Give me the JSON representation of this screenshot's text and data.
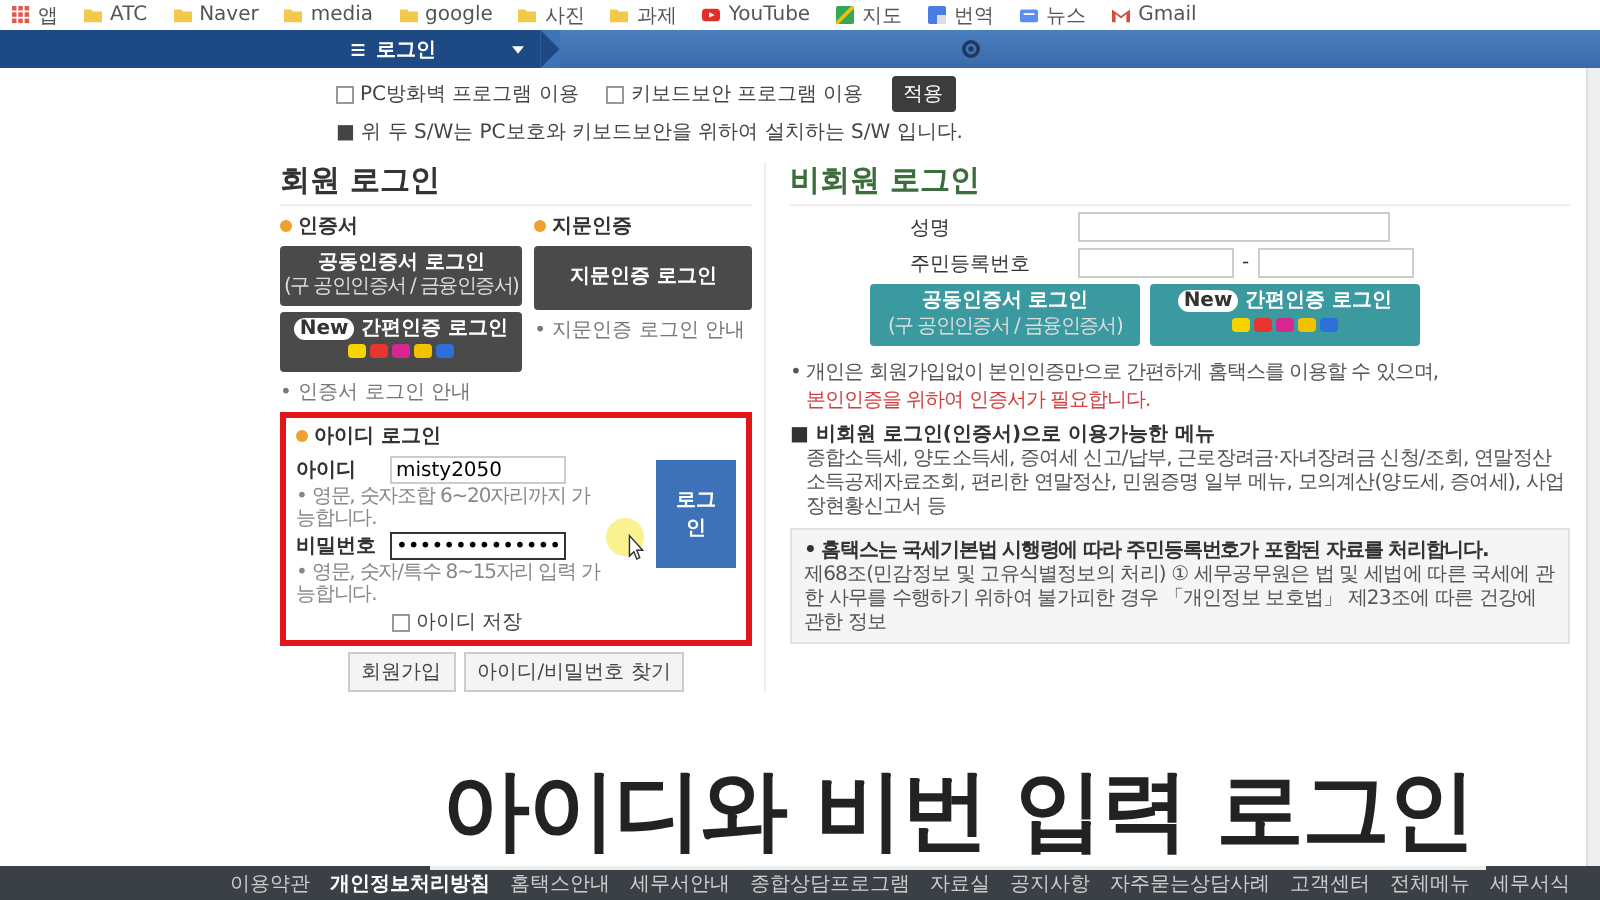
{
  "bookmarks": [
    {
      "kind": "apps",
      "label": "앱"
    },
    {
      "kind": "folder",
      "label": "ATC"
    },
    {
      "kind": "folder",
      "label": "Naver"
    },
    {
      "kind": "folder",
      "label": "media"
    },
    {
      "kind": "folder",
      "label": "google"
    },
    {
      "kind": "folder",
      "label": "사진"
    },
    {
      "kind": "folder",
      "label": "과제"
    },
    {
      "kind": "youtube",
      "label": "YouTube"
    },
    {
      "kind": "map",
      "label": "지도"
    },
    {
      "kind": "translate",
      "label": "번역"
    },
    {
      "kind": "news",
      "label": "뉴스"
    },
    {
      "kind": "gmail",
      "label": "Gmail"
    }
  ],
  "nav": {
    "title": "로그인"
  },
  "options": {
    "checkboxes": [
      {
        "label": "PC방화벽 프로그램 이용",
        "checked": false
      },
      {
        "label": "키보드보안 프로그램 이용",
        "checked": false
      }
    ],
    "apply_button": "적용",
    "note": "■ 위 두 S/W는 PC보호와 키보드보안을 위하여 설치하는 S/W 입니다."
  },
  "member_login": {
    "title": "회원 로그인",
    "certificate": {
      "label": "인증서",
      "button": "공동인증서 로그인",
      "button_sub": "(구 공인인증서 / 금융인증서)",
      "easy_button": {
        "badge": "New",
        "label": "간편인증 로그인",
        "providers": [
          {
            "color": "#f7d300"
          },
          {
            "color": "#e8342f"
          },
          {
            "color": "#d9258f"
          },
          {
            "color": "#f2c200"
          },
          {
            "color": "#2f6fd8"
          }
        ]
      },
      "guide": "• 인증서 로그인 안내"
    },
    "fingerprint": {
      "label": "지문인증",
      "button": "지문인증 로그인",
      "guide": "• 지문인증 로그인 안내"
    },
    "id_login": {
      "label": "아이디 로그인",
      "highlighted": true,
      "id_label": "아이디",
      "id_value": "misty2050",
      "id_hint": "• 영문, 숫자조합 6~20자리까지 가능합니다.",
      "pw_label": "비밀번호",
      "pw_value": "••••••••••••••",
      "pw_hint": "• 영문, 숫자/특수 8~15자리 입력 가능합니다.",
      "save_id": {
        "label": "아이디 저장",
        "checked": false
      },
      "login_button": "로그인"
    },
    "buttons": [
      "회원가입",
      "아이디/비밀번호 찾기"
    ]
  },
  "guest_login": {
    "title": "비회원 로그인",
    "name_label": "성명",
    "rrn_label": "주민등록번호",
    "rrn_separator": "-",
    "cert_button": "공동인증서 로그인",
    "cert_button_sub": "(구 공인인증서 / 금융인증서)",
    "easy_button": {
      "badge": "New",
      "label": "간편인증 로그인",
      "providers": [
        {
          "color": "#f7d300"
        },
        {
          "color": "#e8342f"
        },
        {
          "color": "#d9258f"
        },
        {
          "color": "#f2c200"
        },
        {
          "color": "#2f6fd8"
        }
      ]
    },
    "info": "• 개인은 회원가입없이 본인인증만으로 간편하게 홈택스를 이용할 수 있으며,",
    "info_warning": "본인인증을 위하여 인증서가 필요합니다.",
    "menu_title": "■ 비회원 로그인(인증서)으로 이용가능한 메뉴",
    "menu_body": "종합소득세, 양도소득세, 증여세 신고/납부, 근로장려금·자녀장려금 신청/조회, 연말정산 소득공제자료조회, 편리한 연말정산, 민원증명 일부 메뉴, 모의계산(양도세, 증여세), 사업장현황신고서 등",
    "notice_title": "• 홈택스는 국세기본법 시행령에 따라 주민등록번호가 포함된 자료를 처리합니다.",
    "notice_body": "제68조(민감정보 및 고유식별정보의 처리) ① 세무공무원은 법 및 세법에 따른 국세에 관한 사무를 수행하기 위하여 불가피한 경우 「개인정보 보호법」 제23조에 따른 건강에 관한 정보"
  },
  "caption": "아이디와 비번 입력 로그인",
  "footer": [
    {
      "label": "이용약관",
      "highlighted": false
    },
    {
      "label": "개인정보처리방침",
      "highlighted": true
    },
    {
      "label": "홈택스안내",
      "highlighted": false
    },
    {
      "label": "세무서안내",
      "highlighted": false
    },
    {
      "label": "종합상담프로그램",
      "highlighted": false
    },
    {
      "label": "자료실",
      "highlighted": false
    },
    {
      "label": "공지사항",
      "highlighted": false
    },
    {
      "label": "자주묻는상담사례",
      "highlighted": false
    },
    {
      "label": "고객센터",
      "highlighted": false
    },
    {
      "label": "전체메뉴",
      "highlighted": false
    },
    {
      "label": "세무서식",
      "highlighted": false
    }
  ]
}
